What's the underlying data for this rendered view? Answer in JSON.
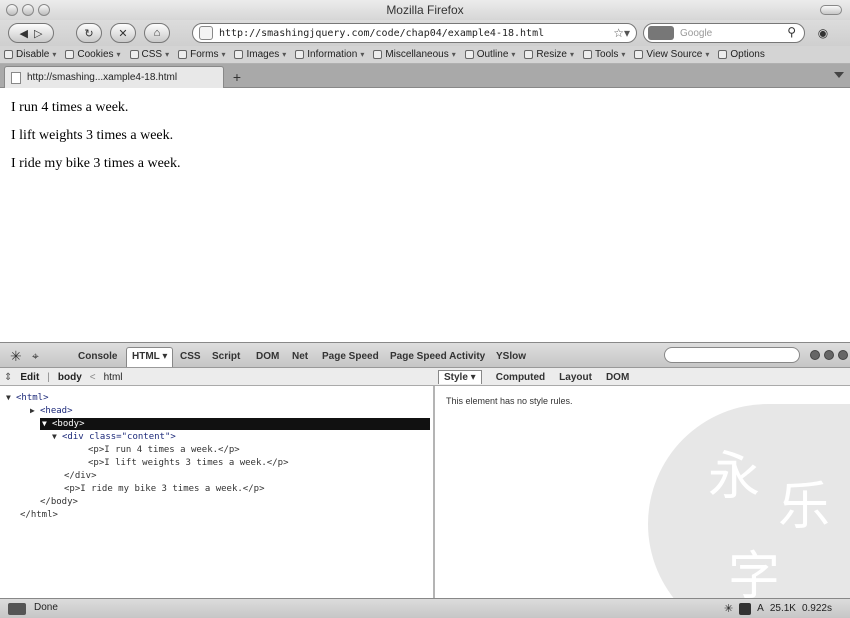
{
  "window": {
    "title": "Mozilla Firefox"
  },
  "nav": {
    "url": "http://smashingjquery.com/code/chap04/example4-18.html",
    "search_placeholder": "Google"
  },
  "devbar": {
    "items": [
      "Disable",
      "Cookies",
      "CSS",
      "Forms",
      "Images",
      "Information",
      "Miscellaneous",
      "Outline",
      "Resize",
      "Tools",
      "View Source",
      "Options"
    ]
  },
  "tab": {
    "label": "http://smashing...xample4-18.html"
  },
  "content": {
    "paragraphs": [
      "I run 4 times a week.",
      "I lift weights 3 times a week.",
      "I ride my bike 3 times a week."
    ]
  },
  "firebug": {
    "tabs": [
      "Console",
      "HTML",
      "CSS",
      "Script",
      "DOM",
      "Net",
      "Page Speed",
      "Page Speed Activity",
      "YSlow"
    ],
    "active_tab": "HTML",
    "toolbar": {
      "edit": "Edit",
      "crumb_body": "body",
      "crumb_html": "html"
    },
    "side_tabs": [
      "Style",
      "Computed",
      "Layout",
      "DOM"
    ],
    "active_side_tab": "Style",
    "style_message": "This element has no style rules.",
    "tree": [
      {
        "twisty": "▼",
        "text": "<html>"
      },
      {
        "twisty": "▶",
        "text": "<head>"
      },
      {
        "twisty": "▼",
        "text": "<body>",
        "selected": true
      },
      {
        "twisty": "▼",
        "text": "<div class=\"content\">"
      },
      {
        "twisty": "",
        "text": "<p>I run 4 times a week.</p>"
      },
      {
        "twisty": "",
        "text": "<p>I lift weights 3 times a week.</p>"
      },
      {
        "twisty": "",
        "text": "</div>"
      },
      {
        "twisty": "",
        "text": "<p>I ride my bike 3 times a week.</p>"
      },
      {
        "twisty": "",
        "text": "</body>"
      },
      {
        "twisty": "",
        "text": "</html>"
      }
    ]
  },
  "status": {
    "text": "Done",
    "size": "25.1K",
    "time": "0.922s",
    "mode_letter": "A"
  }
}
